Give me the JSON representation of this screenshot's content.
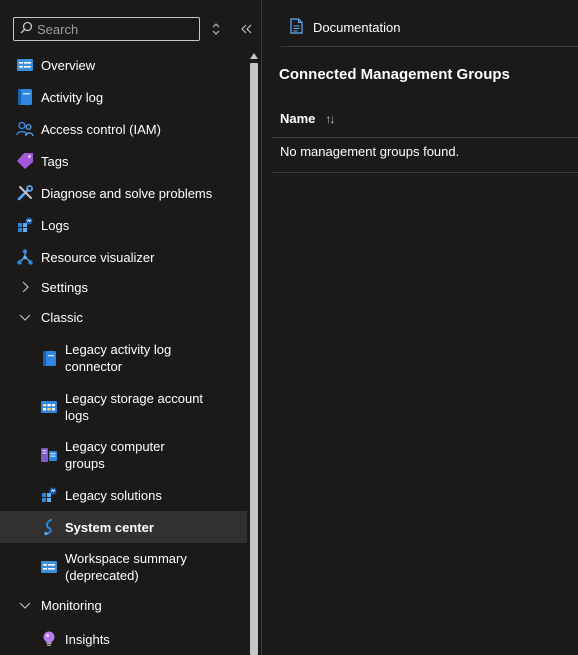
{
  "search": {
    "placeholder": "Search"
  },
  "nav": {
    "overview": "Overview",
    "activity_log": "Activity log",
    "access_control": "Access control (IAM)",
    "tags": "Tags",
    "diagnose": "Diagnose and solve problems",
    "logs": "Logs",
    "resource_visualizer": "Resource visualizer",
    "settings": "Settings",
    "classic": "Classic",
    "legacy_activity_log_connector": "Legacy activity log connector",
    "legacy_storage_account_logs": "Legacy storage account logs",
    "legacy_computer_groups": "Legacy computer groups",
    "legacy_solutions": "Legacy solutions",
    "system_center": "System center",
    "workspace_summary": "Workspace summary (deprecated)",
    "monitoring": "Monitoring",
    "insights": "Insights",
    "selected": "System center"
  },
  "toolbar": {
    "documentation": "Documentation"
  },
  "main": {
    "title": "Connected Management Groups",
    "column_name": "Name",
    "sort_glyph": "↑↓",
    "empty_message": "No management groups found."
  },
  "colors": {
    "background": "#1b1a19",
    "selected": "#323130",
    "accent": "#0078d4",
    "divider": "#3b3a39"
  }
}
